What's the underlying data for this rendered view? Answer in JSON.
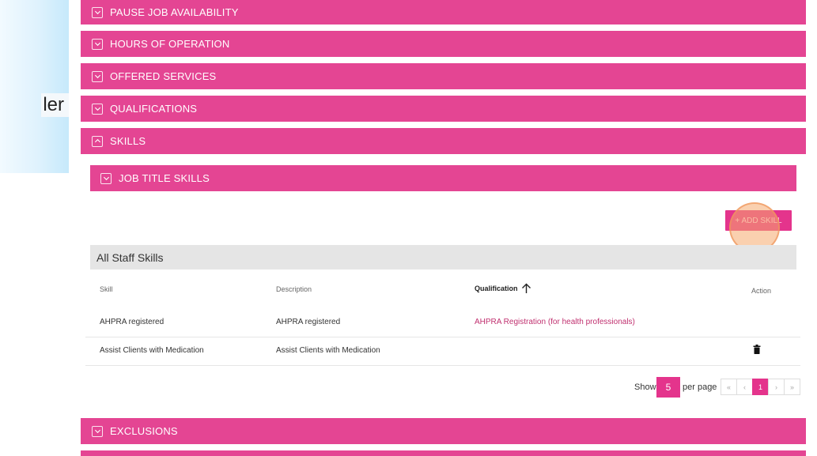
{
  "left_fragment": "ler",
  "accordion": {
    "pause": "PAUSE JOB AVAILABILITY",
    "hours": "HOURS OF OPERATION",
    "services": "OFFERED SERVICES",
    "qualifications": "QUALIFICATIONS",
    "skills": "SKILLS",
    "job_title_skills": "JOB TITLE SKILLS",
    "exclusions": "EXCLUSIONS"
  },
  "add_skill_label": "+ ADD SKILL",
  "table": {
    "title": "All Staff Skills",
    "headers": {
      "skill": "Skill",
      "description": "Description",
      "qualification": "Qualification",
      "action": "Action"
    },
    "rows": [
      {
        "skill": "AHPRA registered",
        "description": "AHPRA registered",
        "qualification": "AHPRA Registration (for health professionals)"
      },
      {
        "skill": "Assist Clients with Medication",
        "description": "Assist Clients with Medication",
        "qualification": ""
      }
    ]
  },
  "pagination": {
    "show": "Show",
    "per_page_value": "5",
    "per_page": "per page",
    "first": "«",
    "prev": "‹",
    "current": "1",
    "next": "›",
    "last": "»"
  },
  "colors": {
    "accent": "#e44593",
    "button": "#e4348c",
    "link": "#c0306f"
  },
  "icons": {
    "collapsed": "chevron-down-icon",
    "expanded": "chevron-up-icon",
    "sort": "arrow-up-icon",
    "delete": "trash-icon"
  }
}
